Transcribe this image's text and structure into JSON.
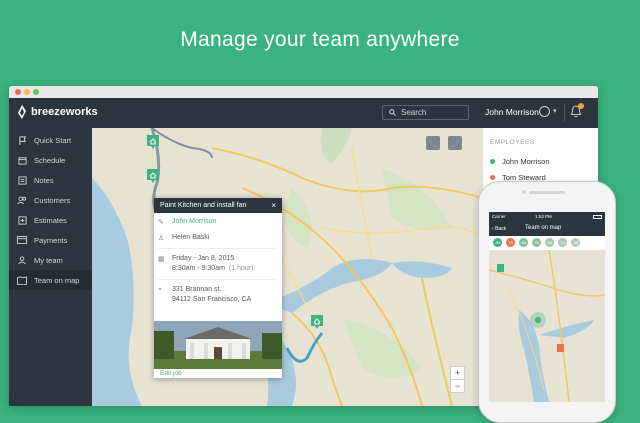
{
  "headline": "Manage your team anywhere",
  "app": {
    "logo_text": "breezeworks",
    "search_placeholder": "Search",
    "user_name": "John Morrison"
  },
  "sidebar": {
    "items": [
      {
        "label": "Quick Start",
        "icon": "flag-icon"
      },
      {
        "label": "Schedule",
        "icon": "calendar-icon"
      },
      {
        "label": "Notes",
        "icon": "notes-icon"
      },
      {
        "label": "Customers",
        "icon": "customers-icon"
      },
      {
        "label": "Estimates",
        "icon": "estimates-icon"
      },
      {
        "label": "Payments",
        "icon": "payments-icon"
      },
      {
        "label": "My team",
        "icon": "team-icon"
      },
      {
        "label": "Team on map",
        "icon": "map-icon",
        "active": true
      }
    ]
  },
  "popup": {
    "title": "Paint Kitchen and install fan",
    "assignee": "John Morrison",
    "customer": "Helen Baski",
    "date": "Friday - Jan 8, 2015",
    "time": "8:30am - 9:30am",
    "duration": "(1 hour)",
    "address_line1": "331 Brannan st.",
    "address_line2": "94112 San Francisco, CA",
    "edit_label": "Edit job"
  },
  "map": {
    "zoom_in": "+",
    "zoom_out": "−"
  },
  "employees": {
    "header": "EMPLOYEES",
    "list": [
      {
        "name": "John Morrison",
        "color": "#3fb27f"
      },
      {
        "name": "Tom Steward",
        "color": "#e8734a"
      }
    ]
  },
  "phone": {
    "carrier": "Carrier",
    "time": "1:53 PM",
    "back_label": "Back",
    "title": "Team on map",
    "avatars": [
      {
        "initials": "JM",
        "color": "#3fb27f"
      },
      {
        "initials": "TS",
        "color": "#e8734a"
      },
      {
        "initials": "JM",
        "color": "#7fbf9a"
      },
      {
        "initials": "TS",
        "color": "#8fbf9a"
      },
      {
        "initials": "JM",
        "color": "#9fc9aa"
      },
      {
        "initials": "TS",
        "color": "#a9c9b2"
      },
      {
        "initials": "JM",
        "color": "#b3cbb8"
      }
    ]
  },
  "colors": {
    "brand": "#3bb380",
    "dark": "#2c3440",
    "accent_orange": "#e8734a"
  }
}
